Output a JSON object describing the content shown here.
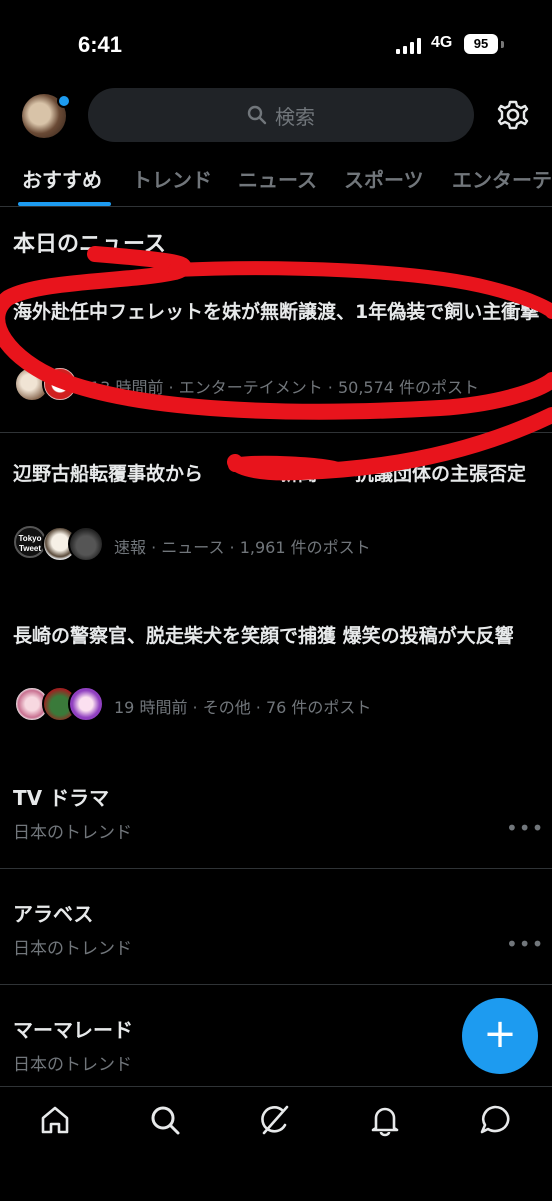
{
  "status": {
    "time": "6:41",
    "network": "4G",
    "battery": "95"
  },
  "search": {
    "placeholder": "検索"
  },
  "tabs": [
    {
      "label": "おすすめ",
      "active": true
    },
    {
      "label": "トレンド"
    },
    {
      "label": "ニュース"
    },
    {
      "label": "スポーツ"
    },
    {
      "label": "エンターテ"
    }
  ],
  "section": {
    "title": "本日のニュース"
  },
  "news": [
    {
      "title": "海外赴任中フェレットを妹が無断譲渡、1年偽装で飼い主衝撃",
      "meta": "13 時間前 · エンターテイメント · 50,574 件のポスト"
    },
    {
      "title": "辺野古船転覆事故から　　　　新聞　　抗議団体の主張否定",
      "meta": "速報 · ニュース · 1,961 件のポスト",
      "avatar_text": "Tokyo Tweet"
    },
    {
      "title": "長崎の警察官、脱走柴犬を笑顔で捕獲 爆笑の投稿が大反響",
      "meta": "19 時間前 · その他 · 76 件のポスト"
    }
  ],
  "trends": [
    {
      "title": "TV ドラマ",
      "subtitle": "日本のトレンド"
    },
    {
      "title": "アラベス",
      "subtitle": "日本のトレンド"
    },
    {
      "title": "マーマレード",
      "subtitle": "日本のトレンド"
    }
  ],
  "fab": {
    "label": "+"
  },
  "icons": {
    "search": "search-icon",
    "settings": "gear-icon",
    "home": "home-icon",
    "grok": "grok-icon",
    "notifications": "bell-icon",
    "messages": "message-icon"
  },
  "colors": {
    "accent": "#1d9bf0",
    "annotation": "#e8141c"
  }
}
